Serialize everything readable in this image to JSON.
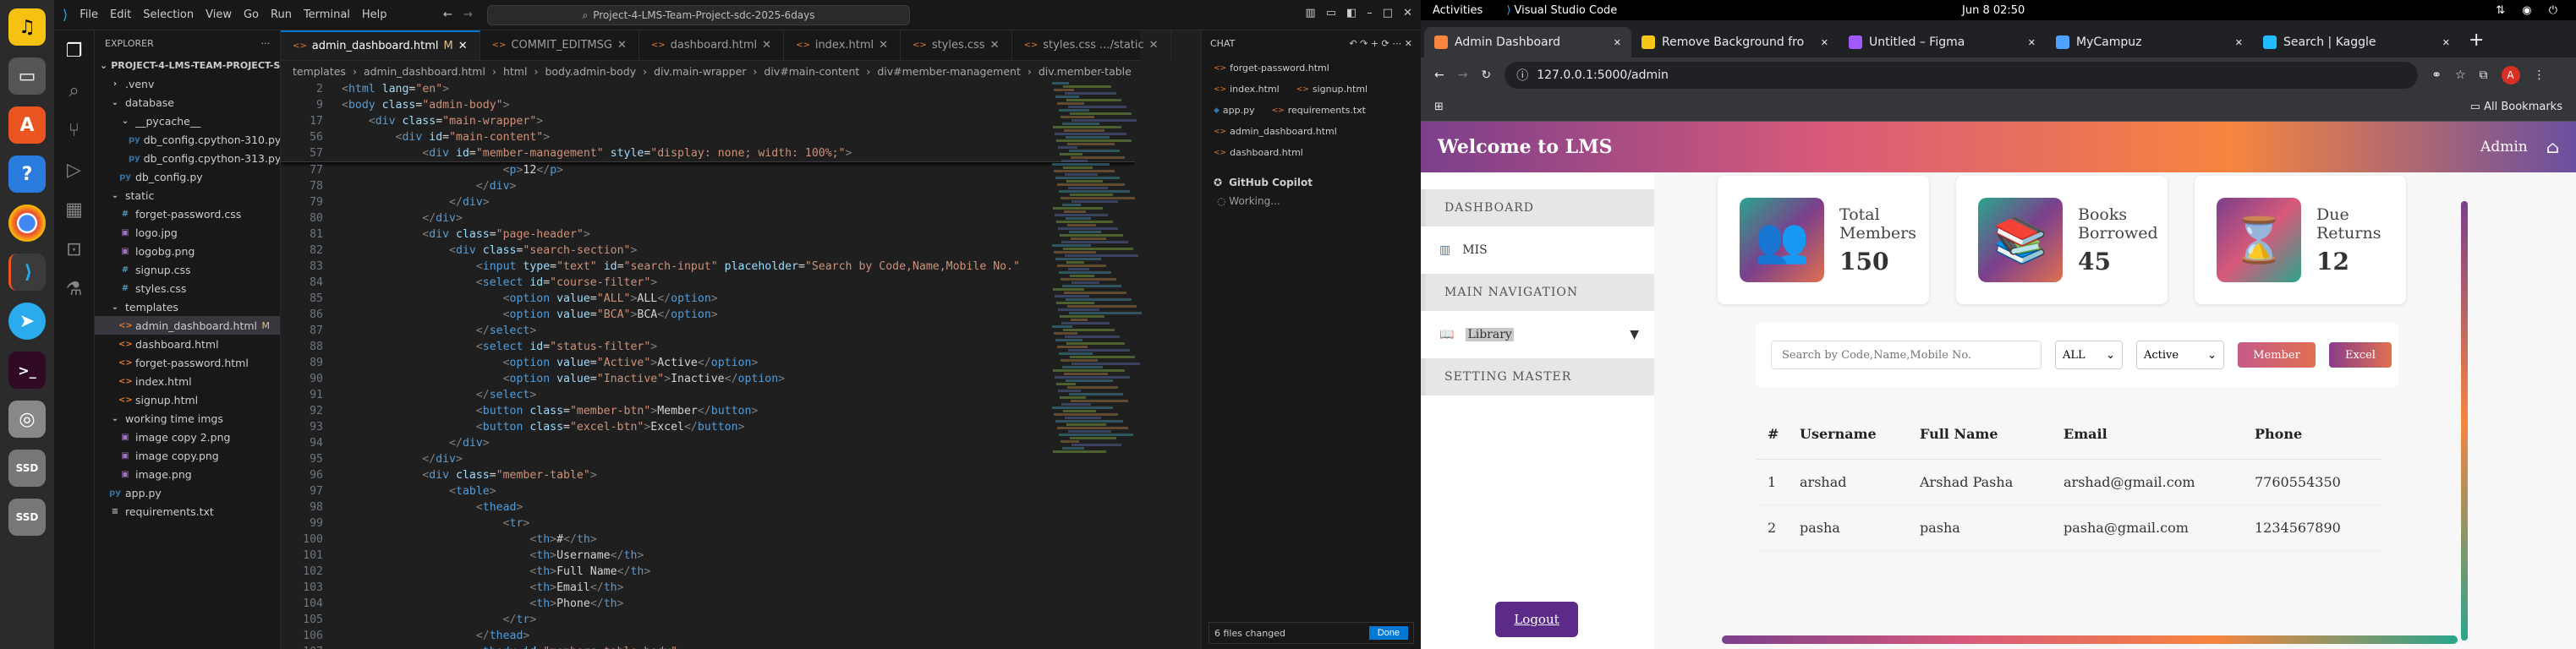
{
  "dock": {
    "apps": [
      "Ubuntu Music",
      "Files",
      "App Center",
      "Help",
      "Chrome",
      "VS Code",
      "Telegram",
      "Terminal",
      "Trash",
      "Disk",
      "Disk2"
    ]
  },
  "vscode": {
    "menu": [
      "File",
      "Edit",
      "Selection",
      "View",
      "Go",
      "Run",
      "Terminal",
      "Help"
    ],
    "search": "Project-4-LMS-Team-Project-sdc-2025-6days",
    "explorer": {
      "header": "EXPLORER",
      "root": "PROJECT-4-LMS-TEAM-PROJECT-S...",
      "items": [
        {
          "name": ".venv",
          "type": "folder",
          "indent": 1
        },
        {
          "name": "database",
          "type": "folder-open",
          "indent": 1
        },
        {
          "name": "__pycache__",
          "type": "folder-open",
          "indent": 2
        },
        {
          "name": "db_config.cpython-310.pyc",
          "type": "pyc",
          "indent": 3
        },
        {
          "name": "db_config.cpython-313.pyc",
          "type": "pyc",
          "indent": 3
        },
        {
          "name": "db_config.py",
          "type": "py",
          "indent": 2
        },
        {
          "name": "static",
          "type": "folder-open",
          "indent": 1
        },
        {
          "name": "forget-password.css",
          "type": "css",
          "indent": 2
        },
        {
          "name": "logo.jpg",
          "type": "img",
          "indent": 2
        },
        {
          "name": "logobg.png",
          "type": "img",
          "indent": 2
        },
        {
          "name": "signup.css",
          "type": "css",
          "indent": 2
        },
        {
          "name": "styles.css",
          "type": "css",
          "indent": 2
        },
        {
          "name": "templates",
          "type": "folder-open",
          "indent": 1
        },
        {
          "name": "admin_dashboard.html",
          "type": "html",
          "indent": 2,
          "selected": true,
          "badge": "M"
        },
        {
          "name": "dashboard.html",
          "type": "html",
          "indent": 2
        },
        {
          "name": "forget-password.html",
          "type": "html",
          "indent": 2
        },
        {
          "name": "index.html",
          "type": "html",
          "indent": 2
        },
        {
          "name": "signup.html",
          "type": "html",
          "indent": 2
        },
        {
          "name": "working time imgs",
          "type": "folder-open",
          "indent": 1
        },
        {
          "name": "image copy 2.png",
          "type": "img",
          "indent": 2
        },
        {
          "name": "image copy.png",
          "type": "img",
          "indent": 2
        },
        {
          "name": "image.png",
          "type": "img",
          "indent": 2
        },
        {
          "name": "app.py",
          "type": "py",
          "indent": 1
        },
        {
          "name": "requirements.txt",
          "type": "txt",
          "indent": 1
        }
      ]
    },
    "tabs": [
      {
        "label": "admin_dashboard.html",
        "mark": "M",
        "active": true
      },
      {
        "label": "COMMIT_EDITMSG"
      },
      {
        "label": "dashboard.html"
      },
      {
        "label": "index.html"
      },
      {
        "label": "styles.css"
      },
      {
        "label": "styles.css .../static"
      }
    ],
    "breadcrumb": [
      "templates",
      "admin_dashboard.html",
      "html",
      "body.admin-body",
      "div.main-wrapper",
      "div#main-content",
      "div#member-management",
      "div.member-table"
    ],
    "sticky_lines": [
      {
        "n": "2",
        "html": "<html lang=\"en\">"
      },
      {
        "n": "9",
        "html": "<body class=\"admin-body\">"
      },
      {
        "n": "17",
        "html": "    <div class=\"main-wrapper\">"
      },
      {
        "n": "56",
        "html": "        <div id=\"main-content\">"
      },
      {
        "n": "57",
        "html": "            <div id=\"member-management\" style=\"display: none; width: 100%;\">"
      }
    ],
    "code_lines": [
      {
        "n": "77",
        "html": "                        <p>12</p>"
      },
      {
        "n": "78",
        "html": "                    </div>"
      },
      {
        "n": "79",
        "html": "                </div>"
      },
      {
        "n": "80",
        "html": "            </div>"
      },
      {
        "n": "81",
        "html": "            <div class=\"page-header\">"
      },
      {
        "n": "82",
        "html": "                <div class=\"search-section\">"
      },
      {
        "n": "83",
        "html": "                    <input type=\"text\" id=\"search-input\" placeholder=\"Search by Code,Name,Mobile No.\""
      },
      {
        "n": "84",
        "html": "                    <select id=\"course-filter\">"
      },
      {
        "n": "85",
        "html": "                        <option value=\"ALL\">ALL</option>"
      },
      {
        "n": "86",
        "html": "                        <option value=\"BCA\">BCA</option>"
      },
      {
        "n": "87",
        "html": "                    </select>"
      },
      {
        "n": "88",
        "html": "                    <select id=\"status-filter\">"
      },
      {
        "n": "89",
        "html": "                        <option value=\"Active\">Active</option>"
      },
      {
        "n": "90",
        "html": "                        <option value=\"Inactive\">Inactive</option>"
      },
      {
        "n": "91",
        "html": "                    </select>"
      },
      {
        "n": "92",
        "html": "                    <button class=\"member-btn\">Member</button>"
      },
      {
        "n": "93",
        "html": "                    <button class=\"excel-btn\">Excel</button>"
      },
      {
        "n": "94",
        "html": "                </div>"
      },
      {
        "n": "95",
        "html": "            </div>"
      },
      {
        "n": "96",
        "html": "            <div class=\"member-table\">"
      },
      {
        "n": "97",
        "html": "                <table>"
      },
      {
        "n": "98",
        "html": "                    <thead>"
      },
      {
        "n": "99",
        "html": "                        <tr>"
      },
      {
        "n": "100",
        "html": "                            <th>#</th>"
      },
      {
        "n": "101",
        "html": "                            <th>Username</th>"
      },
      {
        "n": "102",
        "html": "                            <th>Full Name</th>"
      },
      {
        "n": "103",
        "html": "                            <th>Email</th>"
      },
      {
        "n": "104",
        "html": "                            <th>Phone</th>"
      },
      {
        "n": "105",
        "html": "                        </tr>"
      },
      {
        "n": "106",
        "html": "                    </thead>"
      },
      {
        "n": "107",
        "html": "                    <tbody id=\"members-table-body\">"
      }
    ],
    "chat": {
      "title": "CHAT",
      "files": [
        "forget-password.html",
        "index.html",
        "signup.html",
        "app.py",
        "requirements.txt",
        "admin_dashboard.html",
        "dashboard.html"
      ],
      "copilot": "GitHub Copilot",
      "status": "Working...",
      "changed": "6 files changed",
      "done": "Done"
    }
  },
  "gnome": {
    "activities": "Activities",
    "app": "Visual Studio Code",
    "clock": "Jun 8  02:50"
  },
  "browser": {
    "tabs": [
      {
        "label": "Admin Dashboard",
        "active": true,
        "color": "#f7853f"
      },
      {
        "label": "Remove Background fro",
        "color": "#f5c518"
      },
      {
        "label": "Untitled – Figma",
        "color": "#a259ff"
      },
      {
        "label": "MyCampuz",
        "color": "#4da3ff"
      },
      {
        "label": "Search | Kaggle",
        "color": "#20beff"
      }
    ],
    "url": "127.0.0.1:5000/admin",
    "profile": "A",
    "bookmarks": "All Bookmarks"
  },
  "app": {
    "brand": "Welcome to LMS",
    "user": "Admin",
    "sidebar": {
      "dashboard": "DASHBOARD",
      "mis": "MIS",
      "main_nav": "MAIN NAVIGATION",
      "library": "Library",
      "setting": "SETTING MASTER",
      "logout": "Logout"
    },
    "stats": [
      {
        "label1": "Total",
        "label2": "Members",
        "value": "150",
        "icon": "👥"
      },
      {
        "label1": "Books",
        "label2": "Borrowed",
        "value": "45",
        "icon": "📚"
      },
      {
        "label1": "Due",
        "label2": "Returns",
        "value": "12",
        "icon": "⌛"
      }
    ],
    "filters": {
      "placeholder": "Search by Code,Name,Mobile No.",
      "course": "ALL",
      "status": "Active",
      "member_btn": "Member",
      "excel_btn": "Excel"
    },
    "table": {
      "headers": [
        "#",
        "Username",
        "Full Name",
        "Email",
        "Phone"
      ],
      "rows": [
        [
          "1",
          "arshad",
          "Arshad Pasha",
          "arshad@gmail.com",
          "7760554350"
        ],
        [
          "2",
          "pasha",
          "pasha",
          "pasha@gmail.com",
          "1234567890"
        ]
      ]
    }
  }
}
